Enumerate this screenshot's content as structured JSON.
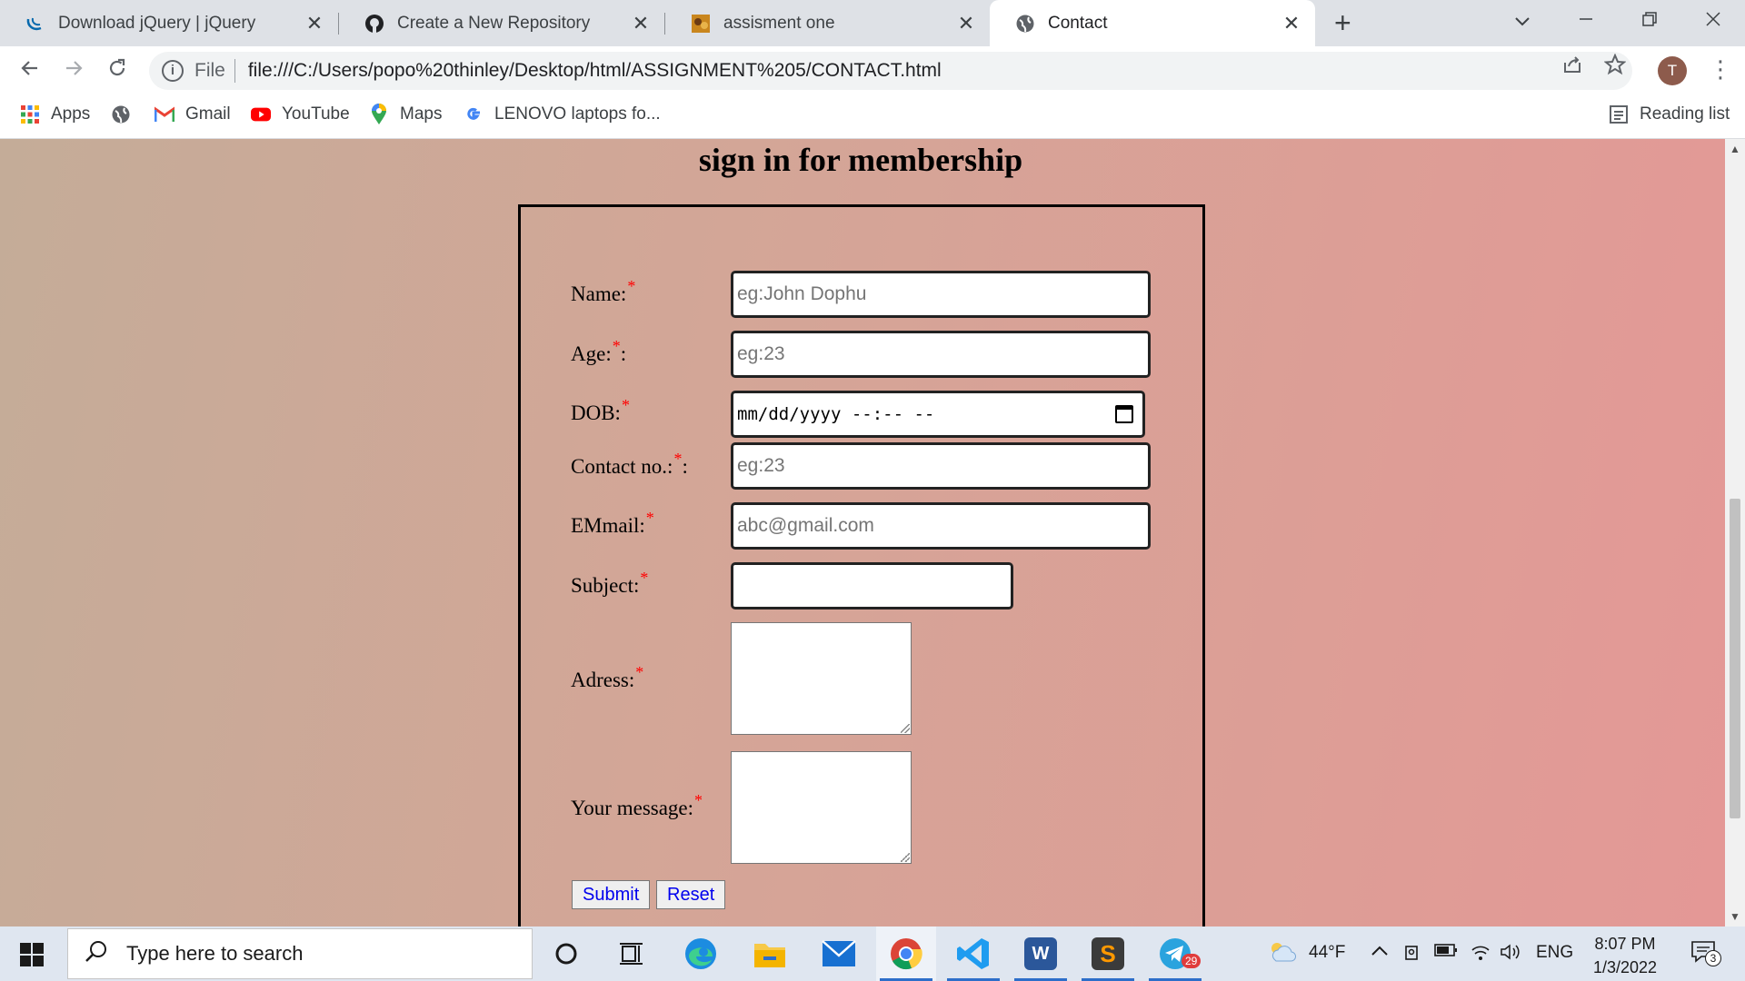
{
  "browser": {
    "tabs": [
      {
        "title": "Download jQuery | jQuery",
        "icon": "jquery-icon"
      },
      {
        "title": "Create a New Repository",
        "icon": "github-icon"
      },
      {
        "title": "assisment one",
        "icon": "image-favicon"
      },
      {
        "title": "Contact",
        "icon": "globe-icon",
        "active": true
      }
    ],
    "new_tab": "+",
    "address": {
      "scheme": "File",
      "url": "file:///C:/Users/popo%20thinley/Desktop/html/ASSIGNMENT%205/CONTACT.html"
    },
    "profile_initial": "T",
    "bookmarks": [
      {
        "label": "Apps",
        "icon": "apps-grid-icon"
      },
      {
        "label": "",
        "icon": "globe-icon"
      },
      {
        "label": "Gmail",
        "icon": "gmail-icon"
      },
      {
        "label": "YouTube",
        "icon": "youtube-icon"
      },
      {
        "label": "Maps",
        "icon": "maps-pin-icon"
      },
      {
        "label": "LENOVO laptops fo...",
        "icon": "google-icon"
      }
    ],
    "reading_list": "Reading list"
  },
  "page": {
    "title": "sign in for membership",
    "required_mark": "*",
    "fields": {
      "name": {
        "label": "Name:",
        "placeholder": "eg:John Dophu"
      },
      "age": {
        "label": "Age:",
        "suffix": ":",
        "placeholder": "eg:23"
      },
      "dob": {
        "label": "DOB:",
        "value": "mm/dd/yyyy --:-- --"
      },
      "contact": {
        "label": "Contact no.:",
        "suffix": ":",
        "placeholder": "eg:23"
      },
      "email": {
        "label": "EMmail:",
        "placeholder": "abc@gmail.com"
      },
      "subject": {
        "label": "Subject:",
        "placeholder": ""
      },
      "address": {
        "label": "Adress:"
      },
      "message": {
        "label": "Your message:"
      }
    },
    "submit_label": "Submit",
    "reset_label": "Reset"
  },
  "taskbar": {
    "search_placeholder": "Type here to search",
    "weather": "44°F",
    "language": "ENG",
    "time": "8:07 PM",
    "date": "1/3/2022",
    "notification_count": "3",
    "telegram_badge": "29"
  },
  "colors": {
    "required": "#ff0000",
    "link_blue": "#0000ee",
    "taskbar_accent": "#2d6ec9"
  }
}
